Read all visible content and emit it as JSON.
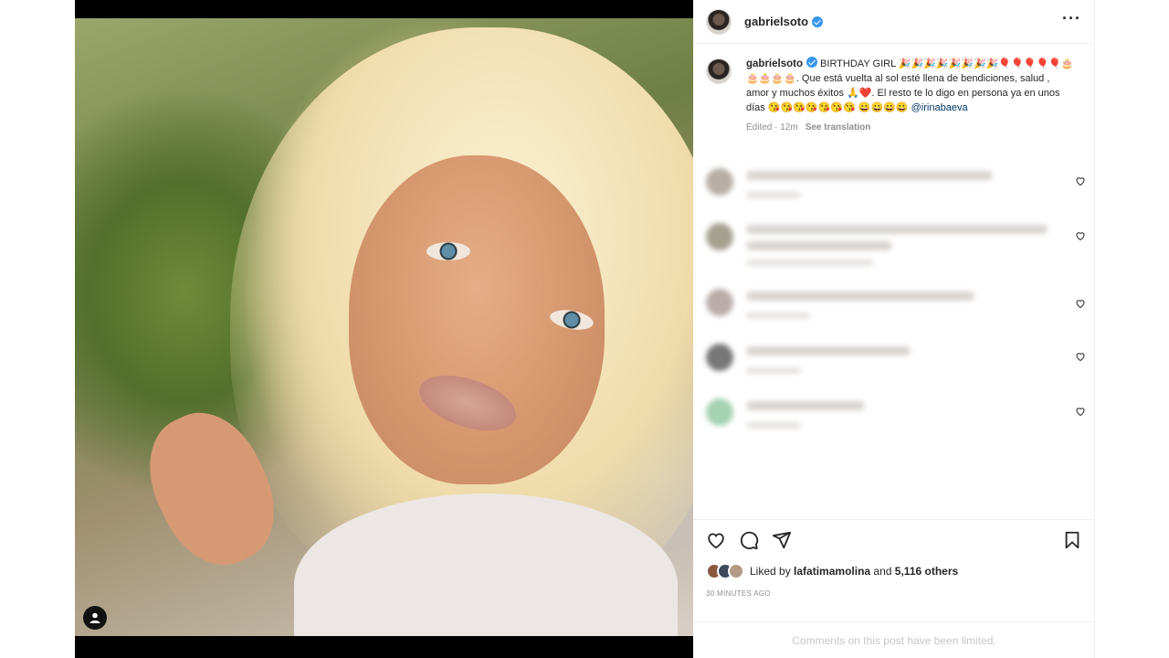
{
  "post": {
    "username": "gabrielsoto",
    "caption_text": "BIRTHDAY GIRL 🎉🎉🎉🎉🎉🎉🎉🎉🎈🎈🎈🎈🎈🎂🎂🎂🎂🎂. Que está vuelta al sol esté llena de bendiciones, salud , amor y muchos éxitos 🙏❤️. El resto te lo digo en persona ya en unos días 😘😘😘😘😘😘😘 😀😀😀😀",
    "mention": "@irinabaeva",
    "edited_label": "Edited · 12m",
    "see_translation": "See translation"
  },
  "likes": {
    "prefix": "Liked by",
    "liker": "lafatimamolina",
    "conjunction": "and",
    "others": "5,116 others"
  },
  "timestamp": "30 MINUTES AGO",
  "comments_limited": "Comments on this post have been limited.",
  "icons": {
    "more": "more-options-icon",
    "like": "heart-icon",
    "comment": "comment-icon",
    "share": "share-icon",
    "save": "bookmark-icon",
    "tag": "user-tag-icon"
  },
  "colors": {
    "verified": "#3897f0",
    "mention": "#00376b",
    "muted": "#8e8e8e"
  }
}
